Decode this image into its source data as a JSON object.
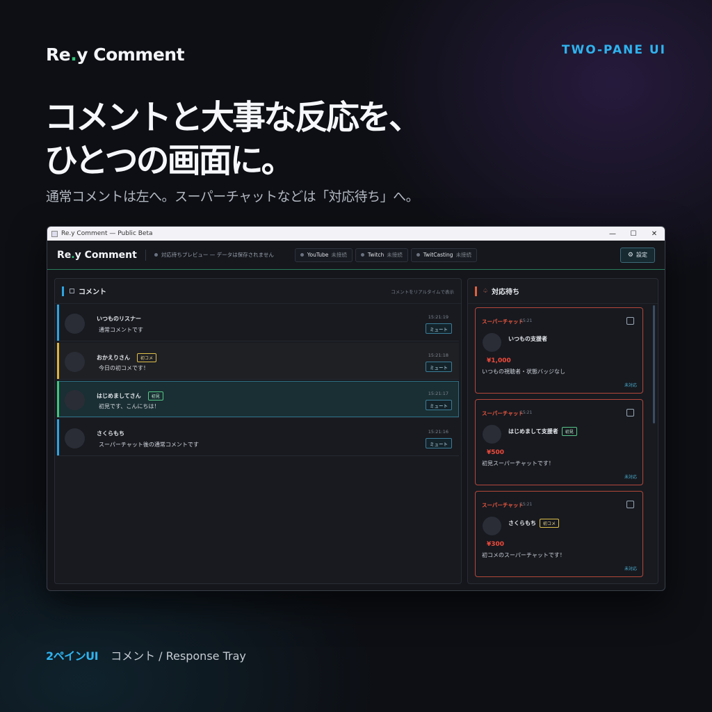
{
  "brand": {
    "name_prefix": "Re",
    "name_dot": ".",
    "name_suffix": "y Comment"
  },
  "tag": "TWO-PANE UI",
  "headline": {
    "line1": "コメントと大事な反応を、",
    "line2": "ひとつの画面に。"
  },
  "subline": "通常コメントは左へ。スーパーチャットなどは「対応待ち」へ。",
  "window": {
    "title": "Re.y Comment — Public Beta",
    "controls": {
      "minimize": "—",
      "maximize": "☐",
      "close": "✕"
    },
    "appbar": {
      "brand_prefix": "Re",
      "brand_dot": ".",
      "brand_suffix": "y Comment",
      "preview_text": "対応待ちプレビュー — データは保存されません",
      "connections": [
        {
          "label": "YouTube",
          "status": "未接続"
        },
        {
          "label": "Twitch",
          "status": "未接続"
        },
        {
          "label": "TwitCasting",
          "status": "未接続"
        }
      ],
      "settings_label": "設定"
    },
    "comments_pane": {
      "title": "コメント",
      "note": "コメントをリアルタイムで表示",
      "mute_label": "ミュート",
      "rows": [
        {
          "name": "いつものリスナー",
          "badge": "",
          "message": "通常コメントです",
          "time": "15:21:19",
          "edge_color": "#2fa4e0",
          "bg": "#181a20"
        },
        {
          "name": "おかえりさん",
          "badge": "初コメ",
          "message": "今日の初コメです！",
          "time": "15:21:18",
          "edge_color": "#e0b43a",
          "bg": "#1f2024"
        },
        {
          "name": "はじめましてさん",
          "badge": "初見",
          "message": "初見です、こんにちは！",
          "time": "15:21:17",
          "edge_color": "#3ec77f",
          "bg": "#1a2f33"
        },
        {
          "name": "さくらもち",
          "badge": "",
          "message": "スーパーチャット後の通常コメントです",
          "time": "15:21:16",
          "edge_color": "#2fa4e0",
          "bg": "#181a20"
        }
      ]
    },
    "response_pane": {
      "title": "対応待ち",
      "cards": [
        {
          "type": "スーパーチャット",
          "time": "15:21",
          "name": "いつもの支援者",
          "badge": "",
          "amount": "¥1,000",
          "message": "いつもの視聴者・状態バッジなし",
          "status": "未対応"
        },
        {
          "type": "スーパーチャット",
          "time": "15:21",
          "name": "はじめまして支援者",
          "badge": "初見",
          "amount": "¥500",
          "message": "初見スーパーチャットです！",
          "status": "未対応"
        },
        {
          "type": "スーパーチャット",
          "time": "15:21",
          "name": "さくらもち",
          "badge": "初コメ",
          "amount": "¥300",
          "message": "初コメのスーパーチャットです！",
          "status": "未対応"
        }
      ]
    }
  },
  "footer": {
    "highlight": "2ペインUI",
    "text": "コメント / Response Tray"
  },
  "colors": {
    "accent": "#2fb3ee",
    "superchat": "#f0583f",
    "brand_dot": "#34c77b"
  }
}
